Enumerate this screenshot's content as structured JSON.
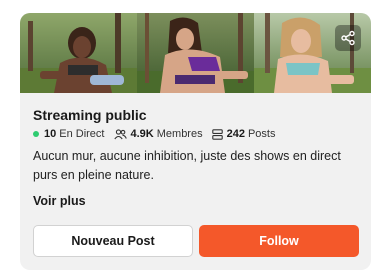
{
  "card": {
    "title": "Streaming public",
    "stats": {
      "live_count": "10",
      "live_label": "En Direct",
      "members_count": "4.9K",
      "members_label": "Membres",
      "posts_count": "242",
      "posts_label": "Posts"
    },
    "description": "Aucun mur, aucune inhibition, juste des shows en direct purs en pleine nature.",
    "see_more_label": "Voir plus",
    "new_post_label": "Nouveau Post",
    "follow_label": "Follow",
    "banner_images": [
      "banner-photo-1",
      "banner-photo-2",
      "banner-photo-3"
    ],
    "share_icon": "share-icon"
  },
  "colors": {
    "accent": "#f4582a",
    "live_dot": "#2ecc71",
    "card_bg": "#f1f1f1"
  }
}
